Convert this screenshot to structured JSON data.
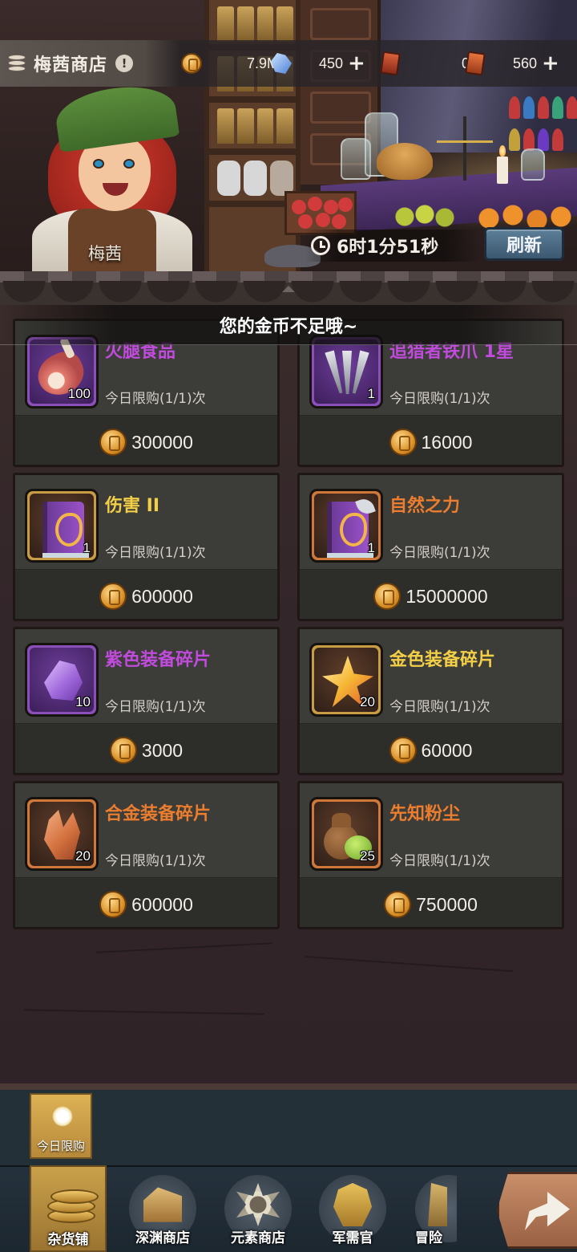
{
  "shop": {
    "title": "梅茜商店",
    "keeper_name": "梅茜",
    "timer": "6时1分51秒",
    "refresh_label": "刷新",
    "toast": "您的金币不足哦~"
  },
  "resources": [
    {
      "icon": "gold-coin-icon",
      "value": "7.9M",
      "has_plus": false
    },
    {
      "icon": "crystal-icon",
      "value": "450",
      "has_plus": true,
      "plus": "+"
    },
    {
      "icon": "ticket-icon",
      "value": "0",
      "has_plus": false
    },
    {
      "icon": "ticket-icon",
      "value": "560",
      "has_plus": true,
      "plus": "+"
    }
  ],
  "items": [
    {
      "name": "火腿食品",
      "qty": "100",
      "limit": "今日限购(1/1)次",
      "price": "300000",
      "rarity": "purple",
      "icon": "ham-icon"
    },
    {
      "name": "追猎者铁爪 1星",
      "qty": "1",
      "limit": "今日限购(1/1)次",
      "price": "16000",
      "rarity": "purple",
      "icon": "claw-icon"
    },
    {
      "name": "伤害 II",
      "qty": "1",
      "limit": "今日限购(1/1)次",
      "price": "600000",
      "rarity": "gold",
      "icon": "spellbook-icon"
    },
    {
      "name": "自然之力",
      "qty": "1",
      "limit": "今日限购(1/1)次",
      "price": "15000000",
      "rarity": "orange",
      "icon": "spellbook-leaf-icon"
    },
    {
      "name": "紫色装备碎片",
      "qty": "10",
      "limit": "今日限购(1/1)次",
      "price": "3000",
      "rarity": "purple",
      "icon": "purple-shard-icon"
    },
    {
      "name": "金色装备碎片",
      "qty": "20",
      "limit": "今日限购(1/1)次",
      "price": "60000",
      "rarity": "gold",
      "icon": "gold-shard-icon"
    },
    {
      "name": "合金装备碎片",
      "qty": "20",
      "limit": "今日限购(1/1)次",
      "price": "600000",
      "rarity": "orange",
      "icon": "alloy-shard-icon"
    },
    {
      "name": "先知粉尘",
      "qty": "25",
      "limit": "今日限购(1/1)次",
      "price": "750000",
      "rarity": "orange",
      "icon": "prophet-dust-icon"
    }
  ],
  "subtabs": [
    {
      "label": "今日限购",
      "icon": "sun-icon"
    }
  ],
  "nav": [
    {
      "label": "杂货铺",
      "icon": "coin-stack-icon",
      "active": true
    },
    {
      "label": "深渊商店",
      "icon": "abyss-shop-icon",
      "active": false
    },
    {
      "label": "元素商店",
      "icon": "element-shop-icon",
      "active": false
    },
    {
      "label": "军需官",
      "icon": "quartermaster-icon",
      "active": false
    },
    {
      "label": "冒险",
      "icon": "adventure-icon",
      "active": false
    }
  ],
  "colors": {
    "purple": "#c04bdc",
    "gold": "#f3cf48",
    "orange": "#eb7d2f",
    "refresh_button": "#4a6a84",
    "nav_active": "#c9a04a"
  }
}
